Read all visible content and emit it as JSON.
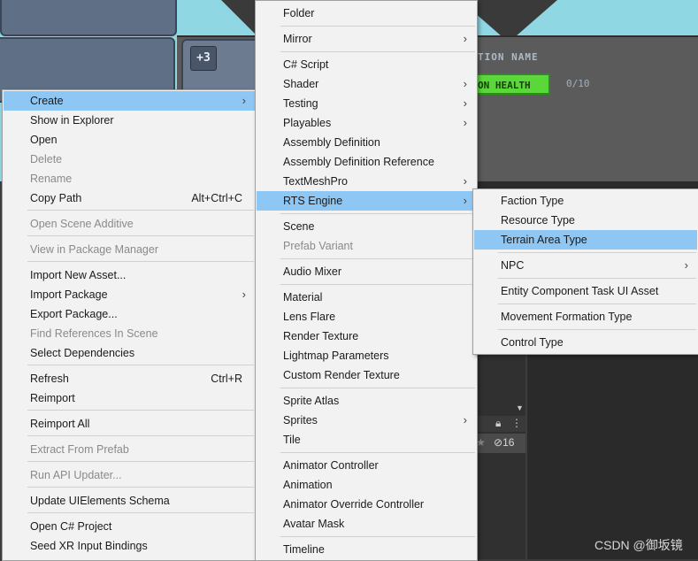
{
  "scene": {
    "plus_badge": "+3",
    "faction_label": "TION NAME",
    "health_label": "ON HEALTH",
    "health_count": "0/10",
    "toolbar_eye_count": "16",
    "watermark": "CSDN @御坂镜"
  },
  "menu1": {
    "items": [
      {
        "label": "Create",
        "arrow": "›",
        "selected": true
      },
      {
        "label": "Show in Explorer"
      },
      {
        "label": "Open"
      },
      {
        "label": "Delete",
        "disabled": true
      },
      {
        "label": "Rename",
        "disabled": true
      },
      {
        "label": "Copy Path",
        "shortcut": "Alt+Ctrl+C"
      },
      {
        "label": "Open Scene Additive",
        "disabled": true
      },
      {
        "label": "View in Package Manager",
        "disabled": true
      },
      {
        "label": "Import New Asset..."
      },
      {
        "label": "Import Package",
        "arrow": "›"
      },
      {
        "label": "Export Package..."
      },
      {
        "label": "Find References In Scene",
        "disabled": true
      },
      {
        "label": "Select Dependencies"
      },
      {
        "label": "Refresh",
        "shortcut": "Ctrl+R"
      },
      {
        "label": "Reimport"
      },
      {
        "label": "Reimport All"
      },
      {
        "label": "Extract From Prefab",
        "disabled": true
      },
      {
        "label": "Run API Updater...",
        "disabled": true
      },
      {
        "label": "Update UIElements Schema"
      },
      {
        "label": "Open C# Project"
      },
      {
        "label": "Seed XR Input Bindings"
      }
    ]
  },
  "menu2": {
    "items": [
      {
        "label": "Folder"
      },
      {
        "label": "Mirror",
        "arrow": "›"
      },
      {
        "label": "C# Script"
      },
      {
        "label": "Shader",
        "arrow": "›"
      },
      {
        "label": "Testing",
        "arrow": "›"
      },
      {
        "label": "Playables",
        "arrow": "›"
      },
      {
        "label": "Assembly Definition"
      },
      {
        "label": "Assembly Definition Reference"
      },
      {
        "label": "TextMeshPro",
        "arrow": "›"
      },
      {
        "label": "RTS Engine",
        "arrow": "›",
        "selected": true
      },
      {
        "label": "Scene"
      },
      {
        "label": "Prefab Variant",
        "disabled": true
      },
      {
        "label": "Audio Mixer"
      },
      {
        "label": "Material"
      },
      {
        "label": "Lens Flare"
      },
      {
        "label": "Render Texture"
      },
      {
        "label": "Lightmap Parameters"
      },
      {
        "label": "Custom Render Texture"
      },
      {
        "label": "Sprite Atlas"
      },
      {
        "label": "Sprites",
        "arrow": "›"
      },
      {
        "label": "Tile"
      },
      {
        "label": "Animator Controller"
      },
      {
        "label": "Animation"
      },
      {
        "label": "Animator Override Controller"
      },
      {
        "label": "Avatar Mask"
      },
      {
        "label": "Timeline"
      }
    ]
  },
  "menu3": {
    "items": [
      {
        "label": "Faction Type"
      },
      {
        "label": "Resource Type"
      },
      {
        "label": "Terrain Area Type",
        "selected": true
      },
      {
        "label": "NPC",
        "arrow": "›"
      },
      {
        "label": "Entity Component Task UI Asset"
      },
      {
        "label": "Movement Formation Type"
      },
      {
        "label": "Control Type"
      }
    ]
  }
}
